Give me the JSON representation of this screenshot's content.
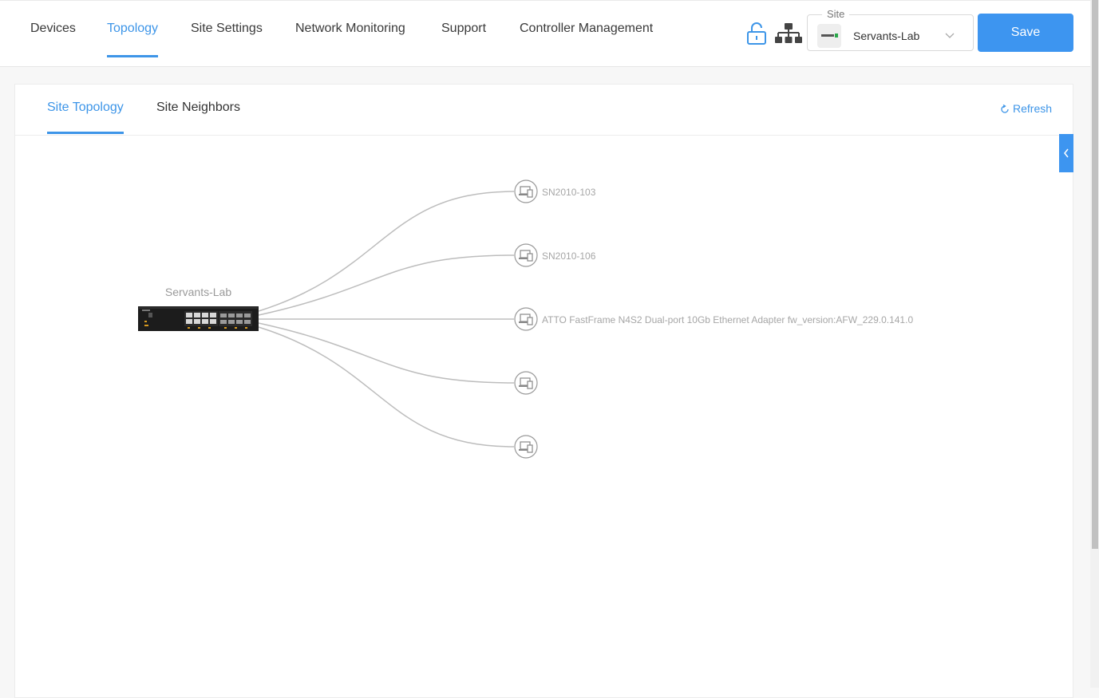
{
  "nav": {
    "tabs": [
      "Devices",
      "Topology",
      "Site Settings",
      "Network Monitoring",
      "Support",
      "Controller Management"
    ],
    "active": "Topology"
  },
  "site": {
    "legend": "Site",
    "value": "Servants-Lab"
  },
  "save_label": "Save",
  "subtabs": {
    "topology": "Site Topology",
    "neighbors": "Site Neighbors",
    "active": "Site Topology"
  },
  "refresh_label": "Refresh",
  "topology": {
    "root": {
      "label": "Servants-Lab"
    },
    "neighbors": [
      {
        "label": "SN2010-103"
      },
      {
        "label": "SN2010-106"
      },
      {
        "label": "ATTO FastFrame N4S2 Dual-port 10Gb Ethernet Adapter fw_version:AFW_229.0.141.0"
      },
      {
        "label": ""
      },
      {
        "label": ""
      }
    ]
  },
  "colors": {
    "accent": "#3d95e8",
    "button": "#3d95f0",
    "link_line": "#bdbdbd"
  }
}
